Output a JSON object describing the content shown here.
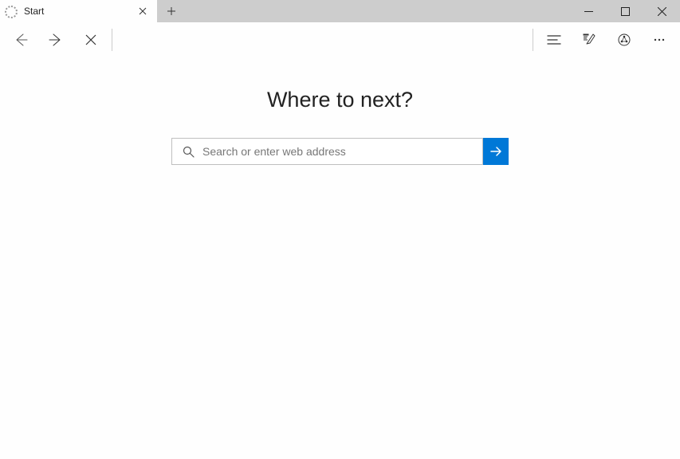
{
  "tab": {
    "title": "Start"
  },
  "page": {
    "heading": "Where to next?",
    "search_placeholder": "Search or enter web address"
  },
  "icons": {
    "tab_spinner": "loading-spinner",
    "tab_close": "close-icon",
    "new_tab": "plus-icon",
    "minimize": "minimize-icon",
    "maximize": "maximize-icon",
    "close": "close-icon",
    "back": "back-arrow-icon",
    "forward": "forward-arrow-icon",
    "stop": "stop-icon",
    "hub": "hub-icon",
    "webnote": "web-note-icon",
    "share": "share-icon",
    "more": "more-icon",
    "search": "search-icon",
    "go": "go-arrow-icon"
  },
  "colors": {
    "accent": "#0078d7",
    "titlebar": "#cdcdcd"
  }
}
